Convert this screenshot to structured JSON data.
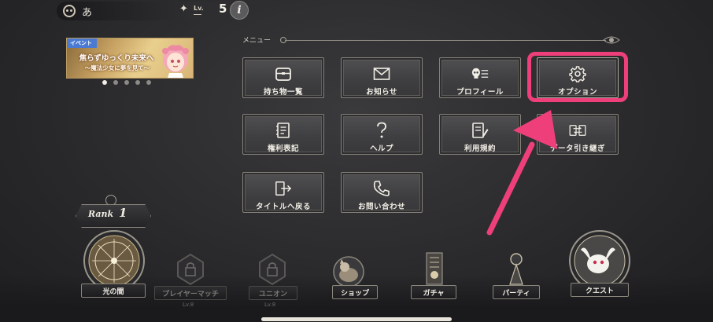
{
  "topbar": {
    "player_name": "あ",
    "level_label": "Lv.",
    "level_value": "5",
    "info_symbol": "i"
  },
  "event_banner": {
    "tag": "イベント",
    "title": "焦らずゆっくり未来へ",
    "subtitle": "〜魔法少女に夢を見て〜",
    "dots_total": 5,
    "active_dot": 0
  },
  "menu": {
    "header_label": "メニュー",
    "buttons": [
      {
        "label": "持ち物一覧",
        "icon": "bag-icon"
      },
      {
        "label": "お知らせ",
        "icon": "envelope-icon"
      },
      {
        "label": "プロフィール",
        "icon": "profile-icon"
      },
      {
        "label": "オプション",
        "icon": "gear-icon",
        "highlighted": true
      },
      {
        "label": "権利表記",
        "icon": "document-icon"
      },
      {
        "label": "ヘルプ",
        "icon": "question-icon"
      },
      {
        "label": "利用規約",
        "icon": "terms-icon"
      },
      {
        "label": "データ引き継ぎ",
        "icon": "transfer-icon"
      },
      {
        "label": "タイトルへ戻る",
        "icon": "exit-icon"
      },
      {
        "label": "お問い合わせ",
        "icon": "phone-icon"
      }
    ]
  },
  "rank": {
    "label": "Rank",
    "value": "1"
  },
  "bottom_nav": {
    "items": [
      {
        "label": "光の間",
        "icon": "light-chamber-icon",
        "enabled": true
      },
      {
        "label": "プレイヤーマッチ",
        "icon": "locked-icon",
        "enabled": false,
        "sublabel": "Lv.8"
      },
      {
        "label": "ユニオン",
        "icon": "locked-icon",
        "enabled": false,
        "sublabel": "Lv.8"
      },
      {
        "label": "ショップ",
        "icon": "shop-icon",
        "enabled": true
      },
      {
        "label": "ガチャ",
        "icon": "gacha-icon",
        "enabled": true
      },
      {
        "label": "パーティ",
        "icon": "party-icon",
        "enabled": true
      },
      {
        "label": "クエスト",
        "icon": "quest-icon",
        "enabled": true
      }
    ]
  },
  "colors": {
    "highlight": "#ee3f7a",
    "background": "#2e2e30",
    "button": "#444446",
    "text": "#f2eee6"
  }
}
